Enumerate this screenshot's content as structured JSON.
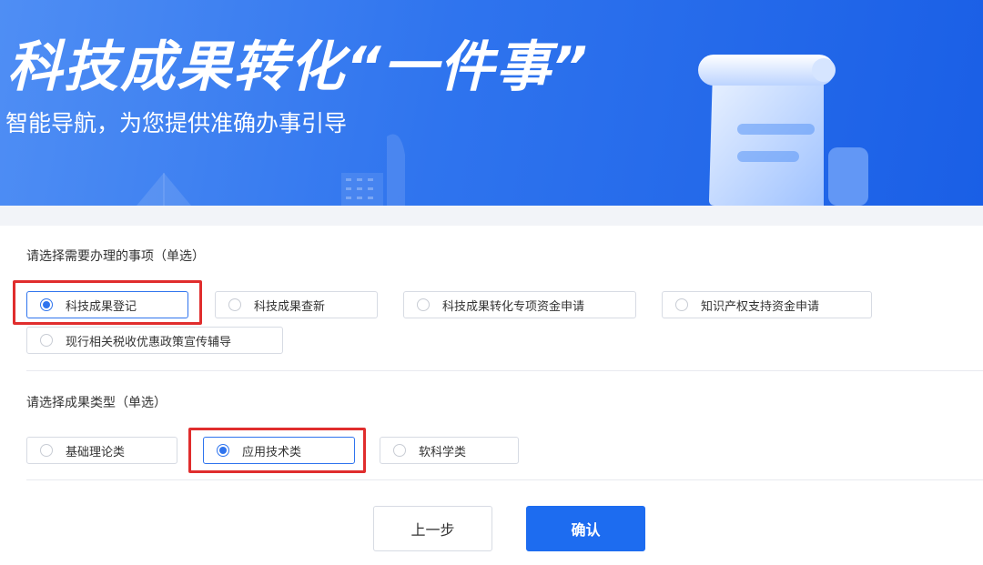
{
  "banner": {
    "title": "科技成果转化“一件事”",
    "subtitle": "智能导航，为您提供准确办事引导"
  },
  "section1": {
    "title": "请选择需要办理的事项（单选）",
    "options": [
      {
        "label": "科技成果登记",
        "selected": true
      },
      {
        "label": "科技成果查新",
        "selected": false
      },
      {
        "label": "科技成果转化专项资金申请",
        "selected": false
      },
      {
        "label": "知识产权支持资金申请",
        "selected": false
      },
      {
        "label": "现行相关税收优惠政策宣传辅导",
        "selected": false
      }
    ]
  },
  "section2": {
    "title": "请选择成果类型（单选）",
    "options": [
      {
        "label": "基础理论类",
        "selected": false
      },
      {
        "label": "应用技术类",
        "selected": true
      },
      {
        "label": "软科学类",
        "selected": false
      }
    ]
  },
  "buttons": {
    "prev": "上一步",
    "confirm": "确认"
  },
  "colors": {
    "accent": "#2f74ee",
    "confirm_bg": "#1d6cf0",
    "highlight": "#e02d2d"
  }
}
